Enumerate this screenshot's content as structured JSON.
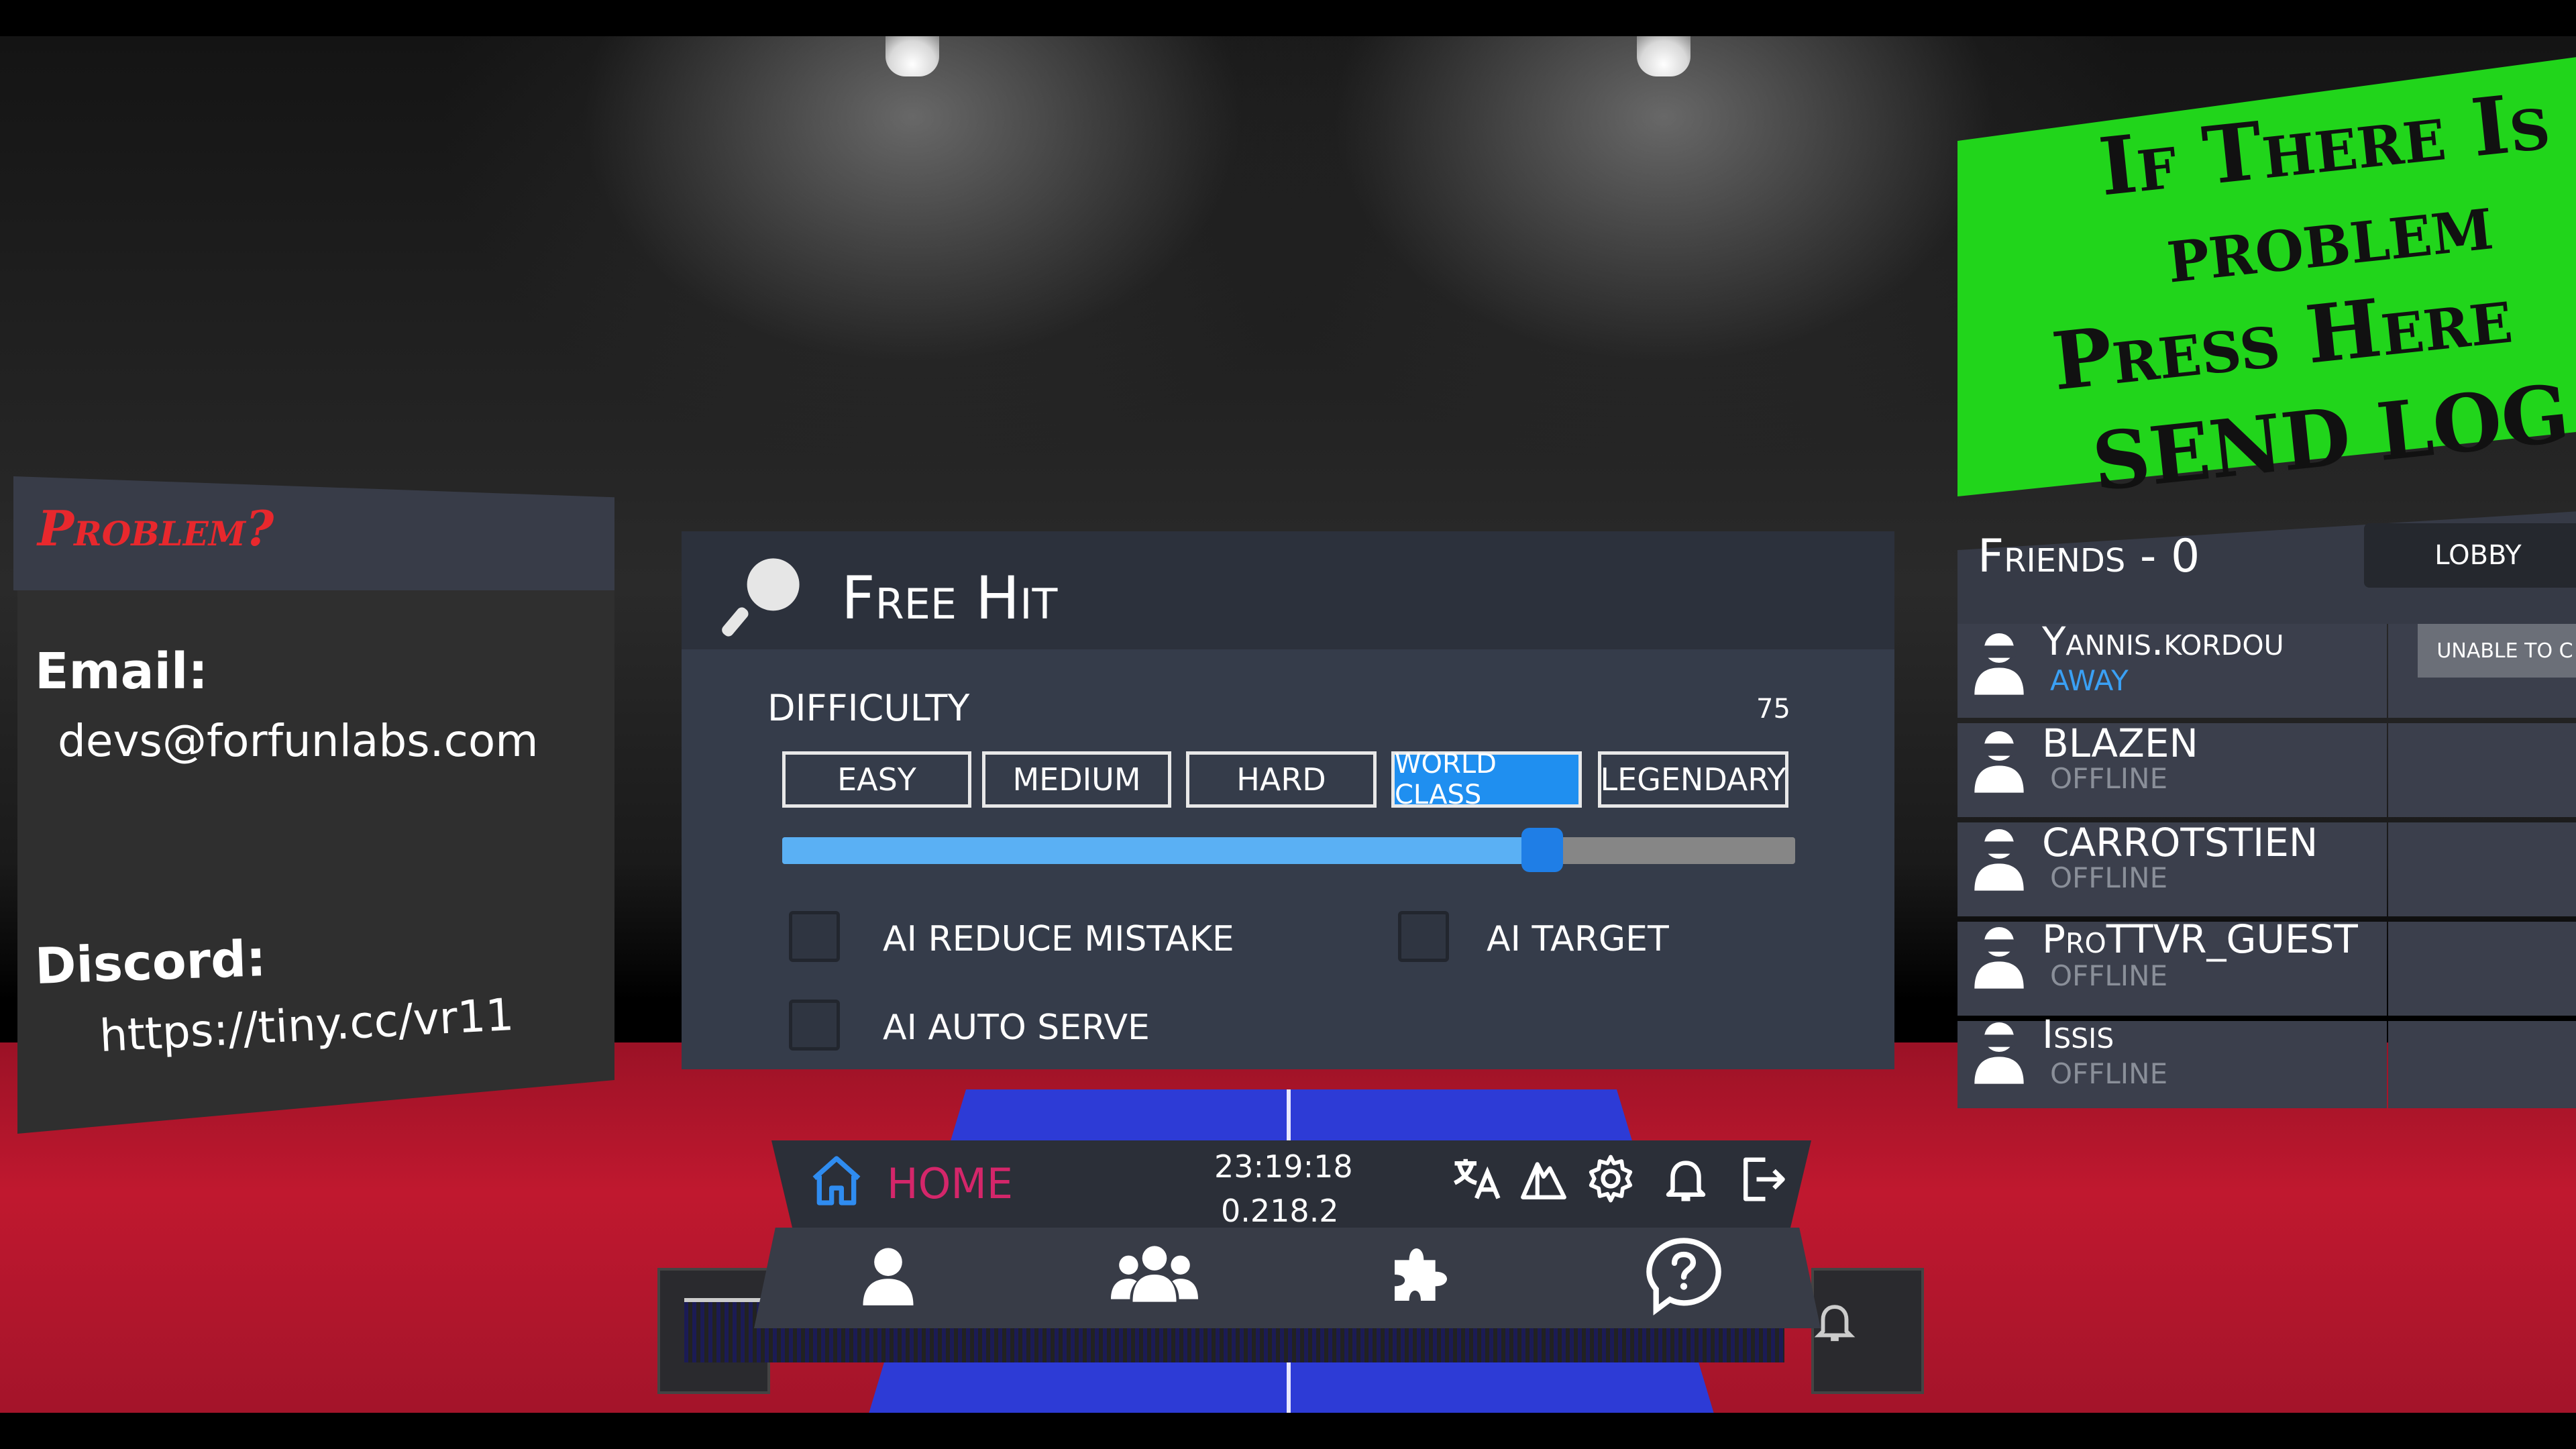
{
  "problem_panel": {
    "title": "Problem?",
    "email_label": "Email:",
    "email_value": "devs@forfunlabs.com",
    "discord_label": "Discord:",
    "discord_value": "https://tiny.cc/vr11"
  },
  "main_panel": {
    "title": "Free Hit",
    "icon": "paddle-icon",
    "difficulty_label": "DIFFICULTY",
    "difficulty_value": "75",
    "difficulty_level": 75,
    "difficulty_buttons": [
      "EASY",
      "MEDIUM",
      "HARD",
      "WORLD CLASS",
      "LEGENDARY"
    ],
    "selected_difficulty": "WORLD CLASS",
    "options": {
      "ai_reduce_mistake": "AI REDUCE MISTAKE",
      "ai_target": "AI TARGET",
      "ai_auto_serve": "AI AUTO SERVE"
    }
  },
  "nav": {
    "home_label": "HOME",
    "time": "23:19:18",
    "version": "0.218.2",
    "top_icons": [
      "translate-icon",
      "mountain-icon",
      "gear-icon",
      "bell-icon",
      "exit-icon"
    ],
    "bottom_icons": [
      "profile-icon",
      "group-icon",
      "puzzle-icon",
      "help-icon"
    ]
  },
  "banner": {
    "lines": [
      "If There Is",
      "problem",
      "Press Here",
      "SEND LOG"
    ]
  },
  "friends": {
    "title": "Friends - 0",
    "lobby_label": "LOBBY",
    "unable_label": "UNABLE TO C",
    "list": [
      {
        "name": "Yannis.kordou",
        "status": "AWAY"
      },
      {
        "name": "BLAZEN",
        "status": "OFFLINE"
      },
      {
        "name": "CARROTSTIEN",
        "status": "OFFLINE"
      },
      {
        "name": "ProTTVR_GUEST",
        "status": "OFFLINE"
      },
      {
        "name": "Issis",
        "status": "OFFLINE"
      }
    ]
  },
  "colors": {
    "accent_blue": "#1f8ff0",
    "home_pink": "#d4266a",
    "banner_green": "#21d51b",
    "problem_red": "#e8282d",
    "away_blue": "#3aa0f4"
  }
}
